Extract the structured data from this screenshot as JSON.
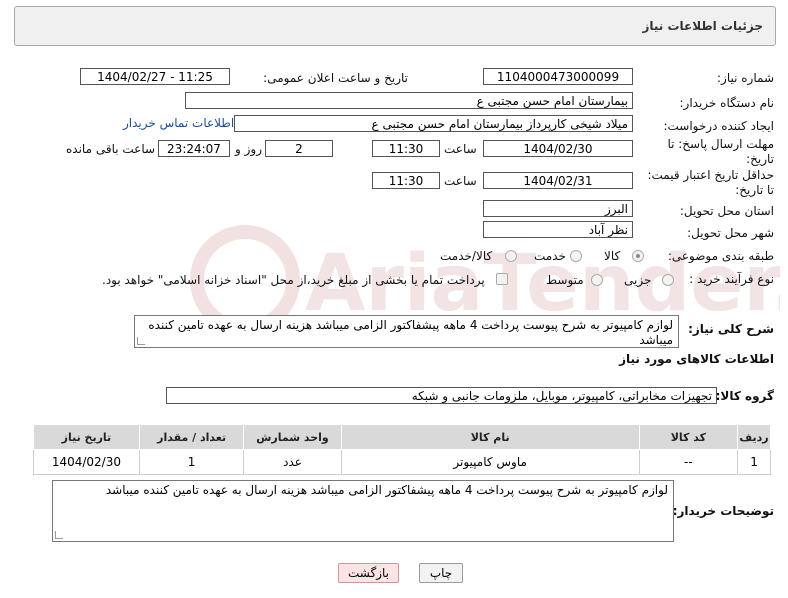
{
  "header": {
    "title": "جزئیات اطلاعات نیاز"
  },
  "form": {
    "need_number_label": "شماره نیاز:",
    "need_number": "1104000473000099",
    "announce_label": "تاریخ و ساعت اعلان عمومی:",
    "announce_value": "1404/02/27 - 11:25",
    "buyer_org_label": "نام دستگاه خریدار:",
    "buyer_org": "بیمارستان امام حسن مجتبی ع",
    "creator_label": "ایجاد کننده درخواست:",
    "creator": "میلاد شیخی کارپرداز بیمارستان امام حسن مجتبی ع",
    "contact_link": "اطلاعات تماس خریدار",
    "deadline_label_1": "مهلت ارسال پاسخ: تا",
    "deadline_label_2": "تاریخ:",
    "deadline_date": "1404/02/30",
    "time_label": "ساعت",
    "deadline_time": "11:30",
    "days_value": "2",
    "days_label": "روز و",
    "remaining_time": "23:24:07",
    "remaining_label": "ساعت باقی مانده",
    "min_price_label_1": "حداقل تاریخ اعتبار قیمت:",
    "min_price_label_2": "تا تاریخ:",
    "min_price_date": "1404/02/31",
    "min_price_time": "11:30",
    "province_label": "استان محل تحویل:",
    "province": "البرز",
    "city_label": "شهر محل تحویل:",
    "city": "نظر آباد",
    "category_label": "طبقه بندی موضوعی:",
    "category_options": [
      "کالا",
      "خدمت",
      "کالا/خدمت"
    ],
    "category_selected": "کالا",
    "process_label": "نوع فرآیند خرید :",
    "process_options": [
      "جزیی",
      "متوسط"
    ],
    "payment_note": "پرداخت تمام یا بخشی از مبلغ خرید،از محل \"اسناد خزانه اسلامی\" خواهد بود.",
    "summary_label": "شرح کلی نیاز:",
    "summary": "لوازم کامپیوتر به شرح پیوست پرداخت 4 ماهه پیشفاکتور الزامی میباشد هزینه ارسال به عهده تامین کننده میباشد"
  },
  "goods": {
    "section_title": "اطلاعات کالاهای مورد نیاز",
    "group_label": "گروه کالا:",
    "group_value": "تجهیزات مخابراتی، کامپیوتر، موبایل، ملزومات جانبی و شبکه",
    "columns": [
      "ردیف",
      "کد کالا",
      "نام کالا",
      "واحد شمارش",
      "تعداد / مقدار",
      "تاریخ نیاز"
    ],
    "rows": [
      [
        "1",
        "--",
        "ماوس کامپیوتر",
        "عدد",
        "1",
        "1404/02/30"
      ]
    ]
  },
  "buyer_notes": {
    "label": "توضیحات خریدار:",
    "text": "لوازم کامپیوتر به شرح پیوست پرداخت 4 ماهه پیشفاکتور الزامی میباشد هزینه ارسال به عهده تامین کننده میباشد"
  },
  "buttons": {
    "print": "چاپ",
    "back": "بازگشت"
  },
  "watermark": {
    "text": "AriaTender.neT",
    "color": "#e8c4c4"
  }
}
